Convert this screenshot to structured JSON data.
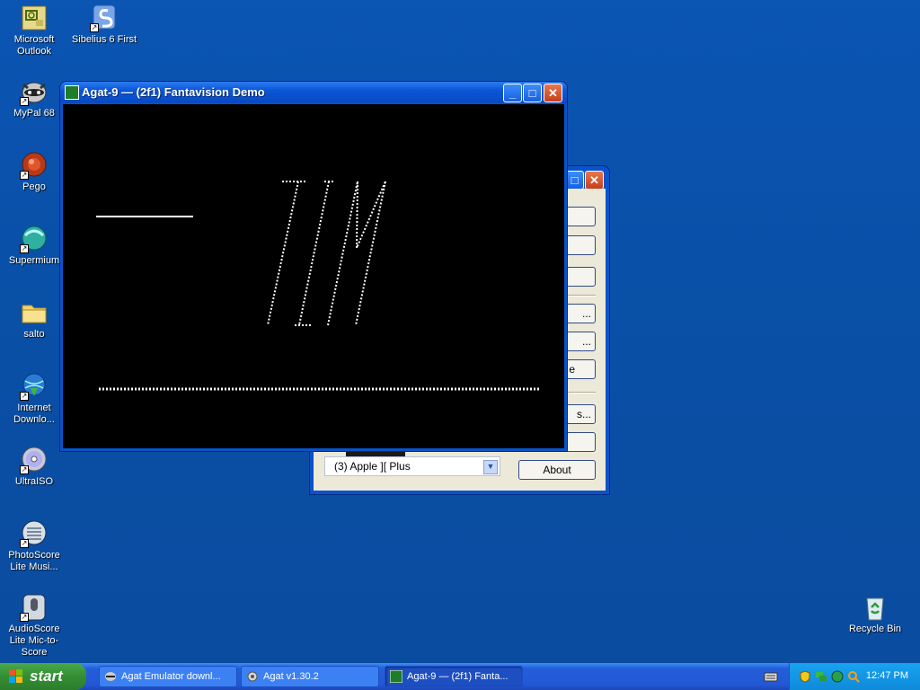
{
  "desktop": {
    "icons": [
      {
        "label": "Microsoft Outlook",
        "icon": "outlook-icon"
      },
      {
        "label": "Sibelius 6 First",
        "icon": "sibelius-icon"
      },
      {
        "label": "MyPal 68",
        "icon": "mypal-raccoon-icon"
      },
      {
        "label": "Pego",
        "icon": "pego-icon"
      },
      {
        "label": "Supermium",
        "icon": "supermium-icon"
      },
      {
        "label": "salto",
        "icon": "folder-icon"
      },
      {
        "label": "Internet Downlo...",
        "icon": "internet-download-icon"
      },
      {
        "label": "UltraISO",
        "icon": "disc-icon"
      },
      {
        "label": "PhotoScore Lite Musi...",
        "icon": "photoscore-icon"
      },
      {
        "label": "AudioScore Lite Mic-to-Score",
        "icon": "audioscore-icon"
      },
      {
        "label": "Recycle Bin",
        "icon": "recycle-bin-icon"
      }
    ]
  },
  "main_window": {
    "title": "Agat-9 — (2f1) Fantavision Demo",
    "screen_text": "TIM"
  },
  "back_window": {
    "title": "Agat v1.30.2",
    "machine_select": "(3) Apple ][ Plus",
    "buttons": [
      "",
      "",
      "",
      "...",
      "...",
      "e",
      "s...",
      "",
      "About"
    ]
  },
  "taskbar": {
    "start_label": "start",
    "tasks": [
      {
        "label": "Agat Emulator downl...",
        "active": false
      },
      {
        "label": "Agat v1.30.2",
        "active": false
      },
      {
        "label": "Agat-9 — (2f1) Fanta...",
        "active": true
      }
    ],
    "clock": "12:47 PM"
  }
}
